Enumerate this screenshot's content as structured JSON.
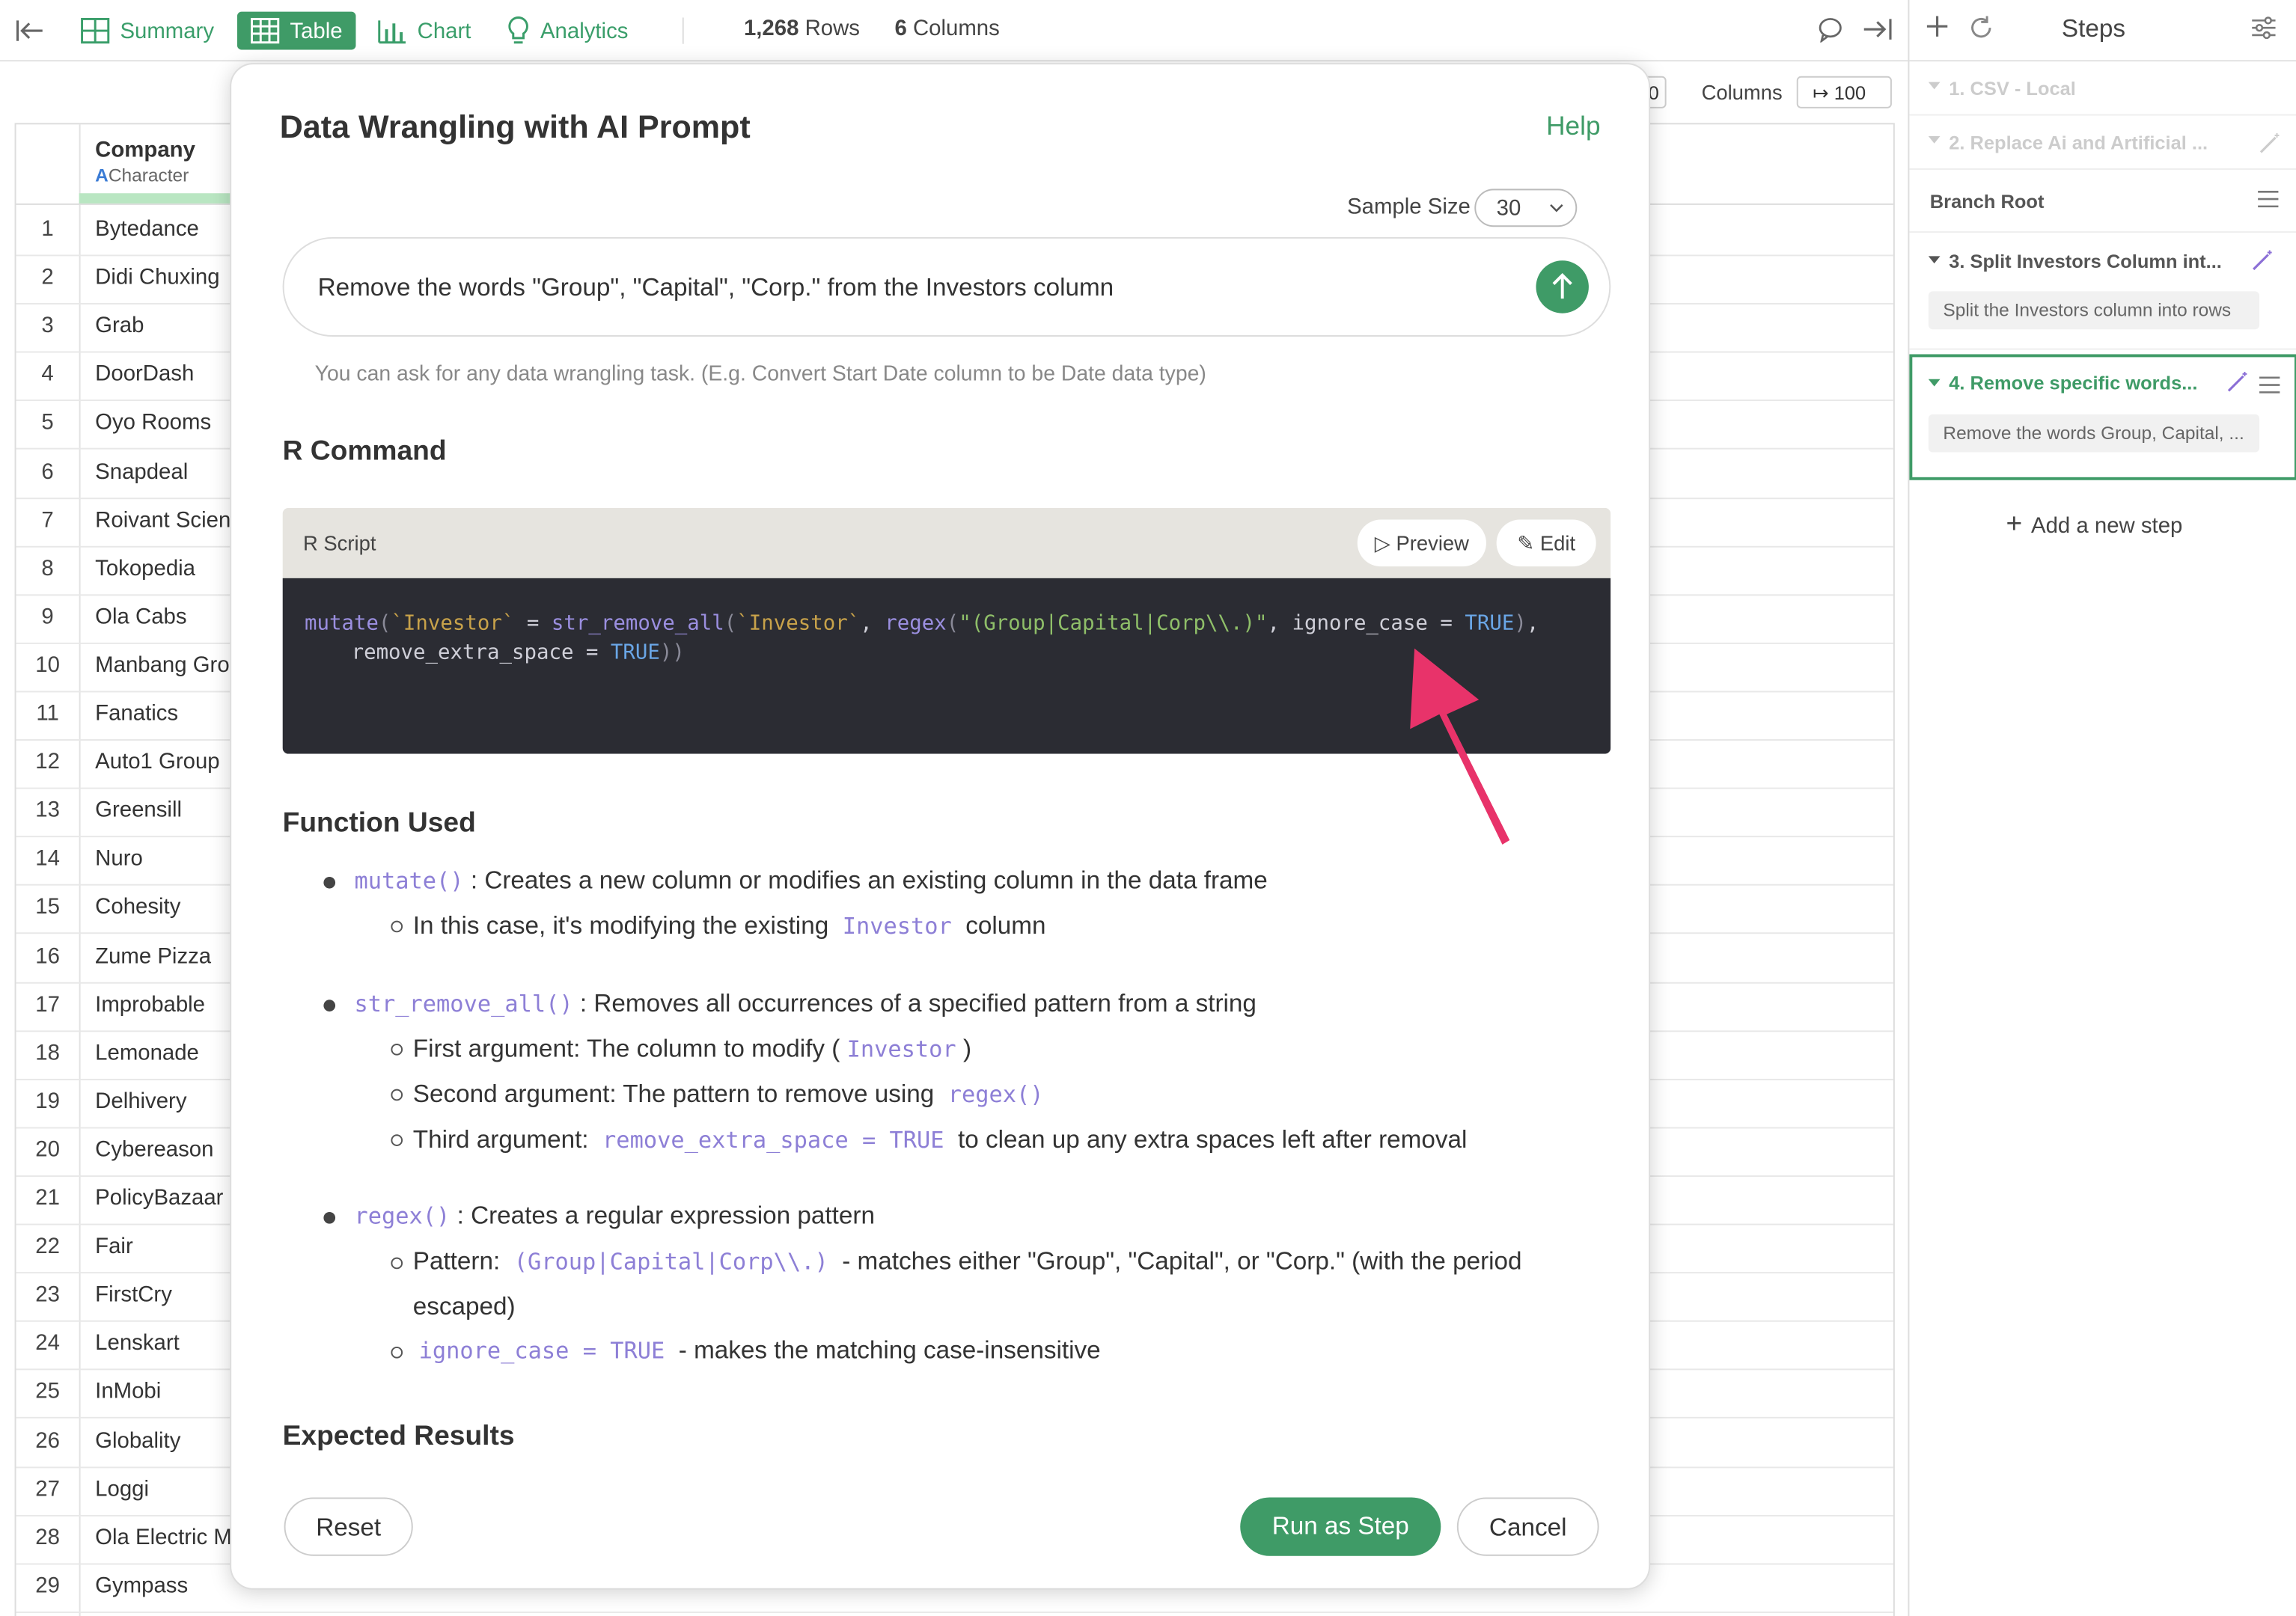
{
  "toolbar": {
    "summary": "Summary",
    "table": "Table",
    "chart": "Chart",
    "analytics": "Analytics",
    "rows_count": "1,268",
    "rows_label": "Rows",
    "columns_count": "6",
    "columns_label": "Columns"
  },
  "table_controls": {
    "columns_label": "Columns",
    "columns_value": "100",
    "partial_value": "0"
  },
  "table": {
    "header": {
      "name": "Company",
      "type": "Character",
      "type_icon": "A"
    },
    "rows": [
      {
        "n": "1",
        "company": "Bytedance"
      },
      {
        "n": "2",
        "company": "Didi Chuxing"
      },
      {
        "n": "3",
        "company": "Grab"
      },
      {
        "n": "4",
        "company": "DoorDash"
      },
      {
        "n": "5",
        "company": "Oyo Rooms"
      },
      {
        "n": "6",
        "company": "Snapdeal"
      },
      {
        "n": "7",
        "company": "Roivant Scien"
      },
      {
        "n": "8",
        "company": "Tokopedia"
      },
      {
        "n": "9",
        "company": "Ola Cabs"
      },
      {
        "n": "10",
        "company": "Manbang Gro"
      },
      {
        "n": "11",
        "company": "Fanatics"
      },
      {
        "n": "12",
        "company": "Auto1 Group"
      },
      {
        "n": "13",
        "company": "Greensill"
      },
      {
        "n": "14",
        "company": "Nuro"
      },
      {
        "n": "15",
        "company": "Cohesity"
      },
      {
        "n": "16",
        "company": "Zume Pizza"
      },
      {
        "n": "17",
        "company": "Improbable"
      },
      {
        "n": "18",
        "company": "Lemonade"
      },
      {
        "n": "19",
        "company": "Delhivery"
      },
      {
        "n": "20",
        "company": "Cybereason"
      },
      {
        "n": "21",
        "company": "PolicyBazaar"
      },
      {
        "n": "22",
        "company": "Fair"
      },
      {
        "n": "23",
        "company": "FirstCry"
      },
      {
        "n": "24",
        "company": "Lenskart"
      },
      {
        "n": "25",
        "company": "InMobi"
      },
      {
        "n": "26",
        "company": "Globality"
      },
      {
        "n": "27",
        "company": "Loggi"
      },
      {
        "n": "28",
        "company": "Ola Electric M"
      },
      {
        "n": "29",
        "company": "Gympass"
      }
    ]
  },
  "steps_panel": {
    "title": "Steps",
    "steps": [
      {
        "label": "1. CSV - Local"
      },
      {
        "label": "2. Replace Ai and Artificial ..."
      }
    ],
    "branch_root": "Branch Root",
    "step3": {
      "label": "3. Split Investors Column int...",
      "desc": "Split the Investors column into rows"
    },
    "step4": {
      "label": "4. Remove specific words...",
      "desc": "Remove the words Group, Capital, ..."
    },
    "add_step": "Add a new step"
  },
  "modal": {
    "title": "Data Wrangling with AI Prompt",
    "help": "Help",
    "sample_size_label": "Sample Size",
    "sample_size_value": "30",
    "prompt": "Remove the words \"Group\", \"Capital\", \"Corp.\" from the Investors column",
    "hint": "You can ask for any data wrangling task. (E.g. Convert Start Date column to be Date data type)",
    "r_command_heading": "R Command",
    "script_label": "R Script",
    "preview": "Preview",
    "edit": "Edit",
    "function_used_heading": "Function Used",
    "expected_results_heading": "Expected Results",
    "functions": {
      "mutate": {
        "code": "mutate()",
        "desc": ": Creates a new column or modifies an existing column in the data frame",
        "sub1_pre": "In this case, it's modifying the existing",
        "sub1_code": "Investor",
        "sub1_post": "column"
      },
      "str_remove_all": {
        "code": "str_remove_all()",
        "desc": ": Removes all occurrences of a specified pattern from a string",
        "sub1_pre": "First argument: The column to modify (",
        "sub1_code": "Investor",
        "sub1_post": ")",
        "sub2_pre": "Second argument: The pattern to remove using",
        "sub2_code": "regex()",
        "sub3_pre": "Third argument:",
        "sub3_code": "remove_extra_space = TRUE",
        "sub3_post": "to clean up any extra spaces left after removal"
      },
      "regex": {
        "code": "regex()",
        "desc": ": Creates a regular expression pattern",
        "sub1_pre": "Pattern:",
        "sub1_code": "(Group|Capital|Corp\\\\.)",
        "sub1_post": "- matches either \"Group\", \"Capital\", or \"Corp.\" (with the period",
        "sub1_cont": "escaped)",
        "sub2_code": "ignore_case = TRUE",
        "sub2_post": "- makes the matching case-insensitive"
      }
    },
    "buttons": {
      "reset": "Reset",
      "run": "Run as Step",
      "cancel": "Cancel"
    }
  },
  "colors": {
    "accent": "#3f9b67",
    "code_bg": "#2b2c33",
    "arrow": "#e8336a"
  }
}
